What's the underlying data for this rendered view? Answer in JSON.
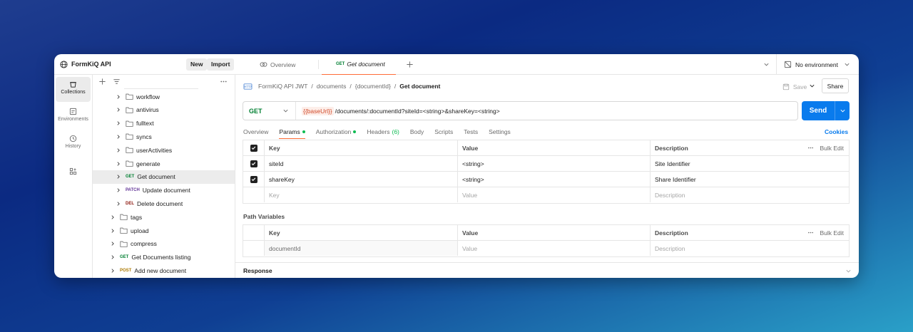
{
  "workspace": {
    "name": "FormKiQ API",
    "new_label": "New",
    "import_label": "Import"
  },
  "rail": [
    {
      "label": "Collections",
      "icon": "collections-icon"
    },
    {
      "label": "Environments",
      "icon": "environments-icon"
    },
    {
      "label": "History",
      "icon": "history-icon"
    }
  ],
  "tree": {
    "items": [
      {
        "type": "folder",
        "label": "workflow",
        "depth": 1
      },
      {
        "type": "folder",
        "label": "antivirus",
        "depth": 1
      },
      {
        "type": "folder",
        "label": "fulltext",
        "depth": 1
      },
      {
        "type": "folder",
        "label": "syncs",
        "depth": 1
      },
      {
        "type": "folder",
        "label": "userActivities",
        "depth": 1
      },
      {
        "type": "folder",
        "label": "generate",
        "depth": 1
      },
      {
        "type": "request",
        "method": "GET",
        "label": "Get document",
        "depth": 1,
        "selected": true
      },
      {
        "type": "request",
        "method": "PATCH",
        "label": "Update document",
        "depth": 1
      },
      {
        "type": "request",
        "method": "DEL",
        "label": "Delete document",
        "depth": 1
      },
      {
        "type": "folder",
        "label": "tags",
        "depth": 0
      },
      {
        "type": "folder",
        "label": "upload",
        "depth": 0
      },
      {
        "type": "folder",
        "label": "compress",
        "depth": 0
      },
      {
        "type": "request",
        "method": "GET",
        "label": "Get Documents listing",
        "depth": 0
      },
      {
        "type": "request",
        "method": "POST",
        "label": "Add new document",
        "depth": 0
      }
    ]
  },
  "tabs": {
    "overview_label": "Overview",
    "active_method": "GET",
    "active_label": "Get document",
    "environment": "No environment"
  },
  "breadcrumb": {
    "items": [
      "FormKiQ API JWT",
      "documents",
      "{documentId}"
    ],
    "current": "Get document",
    "separator": "/"
  },
  "actions": {
    "save_label": "Save",
    "share_label": "Share"
  },
  "request": {
    "method": "GET",
    "url_variable": "{{baseUrl}}",
    "url_rest": "/documents/:documentId?siteId=<string>&shareKey=<string>",
    "send_label": "Send"
  },
  "request_tabs": [
    {
      "label": "Overview"
    },
    {
      "label": "Params",
      "active": true,
      "dot": true
    },
    {
      "label": "Authorization",
      "dot": true
    },
    {
      "label": "Headers",
      "count": "(6)"
    },
    {
      "label": "Body"
    },
    {
      "label": "Scripts"
    },
    {
      "label": "Tests"
    },
    {
      "label": "Settings"
    }
  ],
  "cookies_label": "Cookies",
  "params_table": {
    "headers": {
      "key": "Key",
      "value": "Value",
      "description": "Description",
      "bulk": "Bulk Edit"
    },
    "rows": [
      {
        "key": "siteId",
        "value": "<string>",
        "description": "Site Identifier",
        "checked": true
      },
      {
        "key": "shareKey",
        "value": "<string>",
        "description": "Share Identifier",
        "checked": true
      }
    ],
    "placeholder": {
      "key": "Key",
      "value": "Value",
      "description": "Description"
    }
  },
  "path_variables": {
    "title": "Path Variables",
    "headers": {
      "key": "Key",
      "value": "Value",
      "description": "Description",
      "bulk": "Bulk Edit"
    },
    "rows": [
      {
        "key": "documentId",
        "value": "Value",
        "description": "Description"
      }
    ]
  },
  "response_label": "Response",
  "colors": {
    "accent": "#097bed",
    "tab_underline": "#ff6c37",
    "get": "#007f31",
    "patch": "#623497",
    "del": "#8e1a10",
    "post": "#ad7a03"
  }
}
